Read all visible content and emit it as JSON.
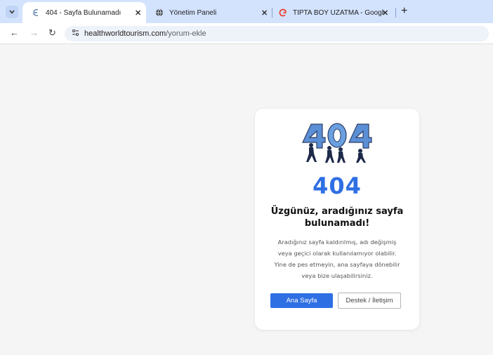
{
  "tabs": [
    {
      "title": "404 - Sayfa Bulunamadı",
      "icon": "e-favicon-icon",
      "active": true
    },
    {
      "title": "Yönetim Paneli",
      "icon": "globe-icon",
      "active": false
    },
    {
      "title": "TIPTA BOY UZATMA - Google'd",
      "icon": "google-icon",
      "active": false
    }
  ],
  "address": {
    "host": "healthworldtourism.com",
    "path": "/yorum-ekle"
  },
  "error": {
    "code": "404",
    "heading": "Üzgünüz, aradığınız sayfa bulunamadı!",
    "line1": "Aradığınız sayfa kaldırılmış, adı değişmiş",
    "line2": "veya geçici olarak kullanılamıyor olabilir.",
    "line3": "Yine de pes etmeyin, ana sayfaya dönebilir",
    "line4": "veya bize ulaşabilirsiniz.",
    "home_button": "Ana Sayfa",
    "support_button": "Destek / İletişim"
  },
  "colors": {
    "accent": "#2f6fe4",
    "tabstrip": "#d3e3fd"
  }
}
